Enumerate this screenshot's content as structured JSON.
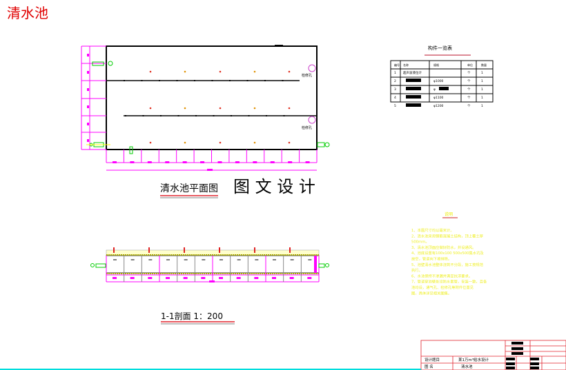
{
  "title": "清水池",
  "plan": {
    "caption": "清水池平面图",
    "manhole_label_1": "检修孔",
    "manhole_label_2": "检修孔"
  },
  "watermark": "图 文 设 计",
  "section": {
    "caption": "1-1剖面 1：200"
  },
  "parts_table": {
    "title": "构件一览表",
    "headers": [
      "编号",
      "名称",
      "规格",
      "单位",
      "数量"
    ],
    "rows": [
      [
        "1",
        "超声波液位计",
        "",
        "个",
        "1"
      ],
      [
        "2",
        "",
        "φ1000",
        "个",
        "1"
      ],
      [
        "3",
        "",
        "φ",
        "个",
        "1"
      ],
      [
        "4",
        "",
        "φ1100",
        "个",
        "1"
      ],
      [
        "5",
        "",
        "φ1200",
        "个",
        "1"
      ]
    ]
  },
  "notes": {
    "heading": "说明",
    "lines": [
      "1、本图尺寸均以毫米计。",
      "2、清水池采用钢筋混凝土结构，顶上覆土厚",
      "   500mm。",
      "3、清水池顶面应做好防水，并设通风。",
      "4、池底设置有100x100 500x500集水坑及",
      "   放空，管道向下坡排除。",
      "5、池壁清水池整体浇筑不分段，施工按规范",
      "   执行。",
      "6、水池保持不渗漏并满足抗浮要求。",
      "7、管道穿池壁处设防水套管，安装一致，且各",
      "   池均设，通气孔、检修孔等附件位置见",
      "   图，具体详见相关图集。"
    ]
  },
  "title_block": {
    "design_topic_label": "设计题目",
    "design_topic_value": "某1万m³给水设计",
    "drawing_name_label": "图  名",
    "drawing_name_value": "清水池"
  },
  "colors": {
    "magenta": "#ff00ff",
    "red": "#e0202a",
    "yellow": "#ffff00",
    "green": "#00dd00",
    "notes": "#ffff33"
  }
}
